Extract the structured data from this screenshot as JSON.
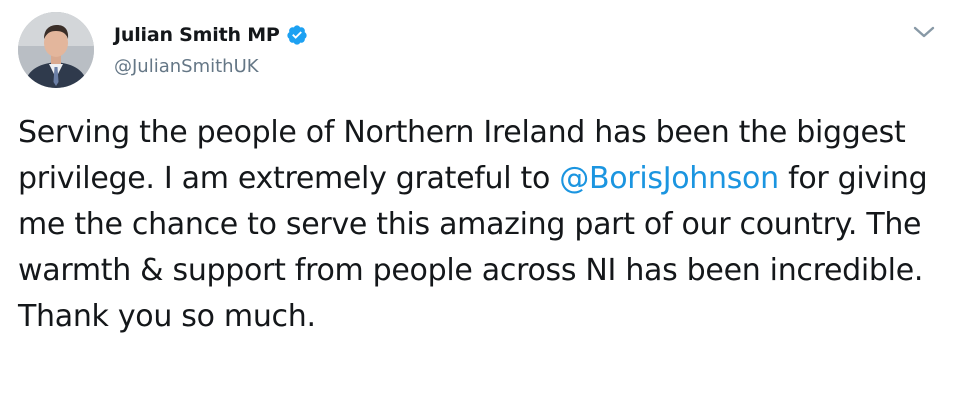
{
  "author": {
    "display_name": "Julian Smith MP",
    "handle": "@JulianSmithUK",
    "verified": true
  },
  "tweet": {
    "text_part1": "Serving the people of Northern Ireland has been the biggest privilege.  I am extremely grateful to ",
    "mention": "@BorisJohnson",
    "text_part2": " for giving me the chance to serve this amazing part of our country. The warmth & support from people across NI has been incredible. Thank you so much."
  },
  "icons": {
    "verified": "verified-badge-icon",
    "more": "chevron-down-icon"
  },
  "colors": {
    "verified": "#1da1f2",
    "mention": "#1b95e0",
    "handle": "#657786",
    "text": "#14171a",
    "caret": "#8899a6"
  }
}
